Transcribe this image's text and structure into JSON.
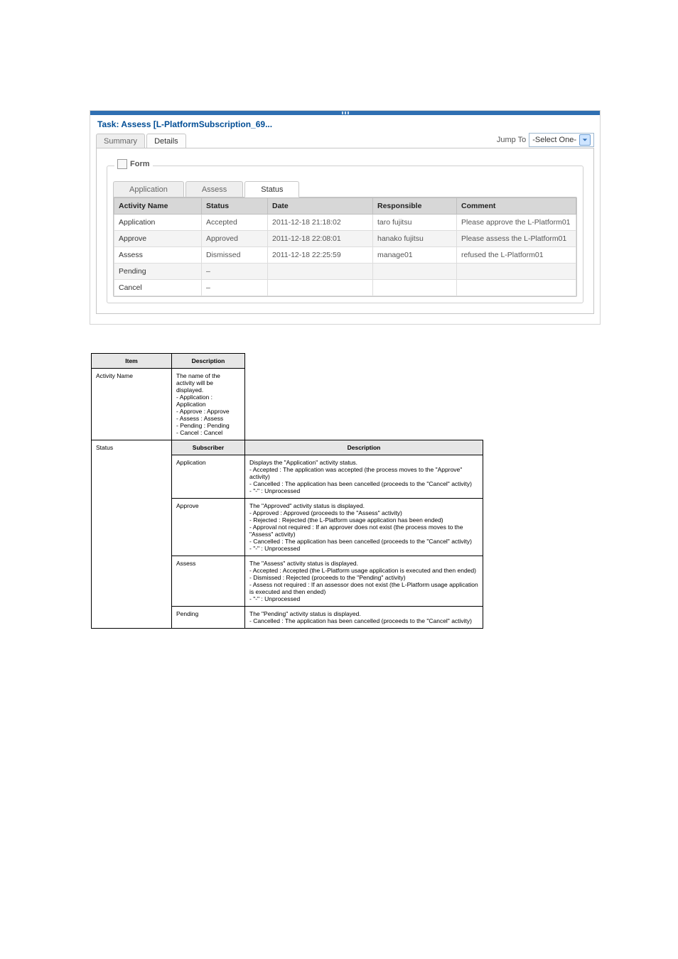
{
  "task_title": "Task: Assess [L-PlatformSubscription_69...",
  "outer_tabs": {
    "summary": "Summary",
    "details": "Details"
  },
  "jump_to_label": "Jump To",
  "jump_to_value": "-Select One-",
  "form_legend": "Form",
  "inner_tabs": {
    "application": "Application",
    "assess": "Assess",
    "status": "Status"
  },
  "status_table": {
    "headers": [
      "Activity Name",
      "Status",
      "Date",
      "Responsible",
      "Comment"
    ],
    "rows": [
      {
        "activity": "Application",
        "status": "Accepted",
        "date": "2011-12-18 21:18:02",
        "responsible": "taro fujitsu",
        "comment": "Please approve the L-Platform01"
      },
      {
        "activity": "Approve",
        "status": "Approved",
        "date": "2011-12-18 22:08:01",
        "responsible": "hanako fujitsu",
        "comment": "Please assess the L-Platform01"
      },
      {
        "activity": "Assess",
        "status": "Dismissed",
        "date": "2011-12-18 22:25:59",
        "responsible": "manage01",
        "comment": "refused the L-Platform01"
      },
      {
        "activity": "Pending",
        "status": "–",
        "date": "",
        "responsible": "",
        "comment": ""
      },
      {
        "activity": "Cancel",
        "status": "–",
        "date": "",
        "responsible": "",
        "comment": ""
      }
    ]
  },
  "desc_table": {
    "header": [
      "Item",
      "Description"
    ],
    "rows": [
      {
        "c0": "Activity Name",
        "c1": "The name of the activity will be displayed.\n- Application : Application\n- Approve : Approve\n- Assess : Assess\n- Pending : Pending\n- Cancel : Cancel"
      },
      {
        "c0": "Status",
        "c1": "",
        "sub_h": [
          "Subscriber",
          "Description"
        ],
        "subs": [
          {
            "s": "Application",
            "d": "Displays the \"Application\" activity status.\n- Accepted : The application was accepted (the process moves to the \"Approve\" activity)\n- Cancelled : The application has been cancelled (proceeds to the \"Cancel\" activity)\n- \"-\" : Unprocessed"
          },
          {
            "s": "Approve",
            "d": "The \"Approved\" activity status is displayed.\n- Approved : Approved (proceeds to the \"Assess\" activity)\n- Rejected : Rejected (the L-Platform usage application has been ended)\n- Approval not required : If an approver does not exist (the process moves to the \"Assess\" activity)\n- Cancelled : The application has been cancelled (proceeds to the \"Cancel\" activity)\n- \"-\" : Unprocessed"
          },
          {
            "s": "Assess",
            "d": "The \"Assess\" activity status is displayed.\n- Accepted : Accepted (the L-Platform usage application is executed and then ended)\n- Dismissed : Rejected (proceeds to the \"Pending\" activity)\n- Assess not required : If an assessor does not exist (the L-Platform usage application is executed and then ended)\n- \"-\" : Unprocessed"
          },
          {
            "s": "Pending",
            "d": "The \"Pending\" activity status is displayed.\n- Cancelled : The application has been cancelled (proceeds to the \"Cancel\" activity)"
          }
        ]
      }
    ]
  }
}
